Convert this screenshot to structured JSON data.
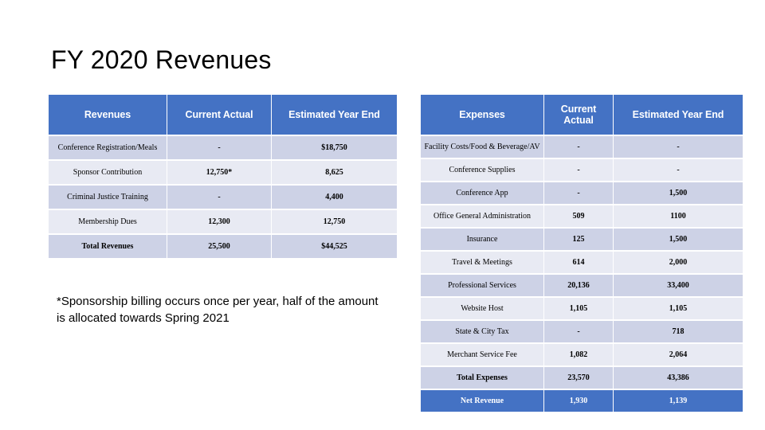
{
  "slide": {
    "title": "FY 2020 Revenues",
    "footnote": "*Sponsorship billing occurs once per year, half of the amount is allocated towards Spring 2021"
  },
  "colors": {
    "header_blue": "#4472C4",
    "row_dark": "#CDD2E6",
    "row_light": "#E8EAF3",
    "text": "#000000",
    "header_text": "#FFFFFF"
  },
  "revenues_table": {
    "headers": [
      "Revenues",
      "Current Actual",
      "Estimated Year End"
    ],
    "rows": [
      {
        "label": "Conference Registration/Meals",
        "current_actual": "-",
        "estimated_year_end": "$18,750"
      },
      {
        "label": "Sponsor Contribution",
        "current_actual": "12,750*",
        "estimated_year_end": "8,625"
      },
      {
        "label": "Criminal Justice Training",
        "current_actual": "-",
        "estimated_year_end": "4,400"
      },
      {
        "label": "Membership Dues",
        "current_actual": "12,300",
        "estimated_year_end": "12,750"
      },
      {
        "label": "Total Revenues",
        "current_actual": "25,500",
        "estimated_year_end": "$44,525"
      }
    ]
  },
  "expenses_table": {
    "headers": [
      "Expenses",
      "Current Actual",
      "Estimated Year End"
    ],
    "rows": [
      {
        "label": "Facility Costs/Food & Beverage/AV",
        "current_actual": "-",
        "estimated_year_end": "-"
      },
      {
        "label": "Conference Supplies",
        "current_actual": "-",
        "estimated_year_end": "-"
      },
      {
        "label": "Conference App",
        "current_actual": "-",
        "estimated_year_end": "1,500"
      },
      {
        "label": "Office General Administration",
        "current_actual": "509",
        "estimated_year_end": "1100"
      },
      {
        "label": "Insurance",
        "current_actual": "125",
        "estimated_year_end": "1,500"
      },
      {
        "label": "Travel & Meetings",
        "current_actual": "614",
        "estimated_year_end": "2,000"
      },
      {
        "label": "Professional Services",
        "current_actual": "20,136",
        "estimated_year_end": "33,400"
      },
      {
        "label": "Website Host",
        "current_actual": "1,105",
        "estimated_year_end": "1,105"
      },
      {
        "label": "State & City Tax",
        "current_actual": "-",
        "estimated_year_end": "718"
      },
      {
        "label": "Merchant Service Fee",
        "current_actual": "1,082",
        "estimated_year_end": "2,064"
      },
      {
        "label": "Total Expenses",
        "current_actual": "23,570",
        "estimated_year_end": "43,386"
      },
      {
        "label": "Net Revenue",
        "current_actual": "1,930",
        "estimated_year_end": "1,139"
      }
    ]
  }
}
